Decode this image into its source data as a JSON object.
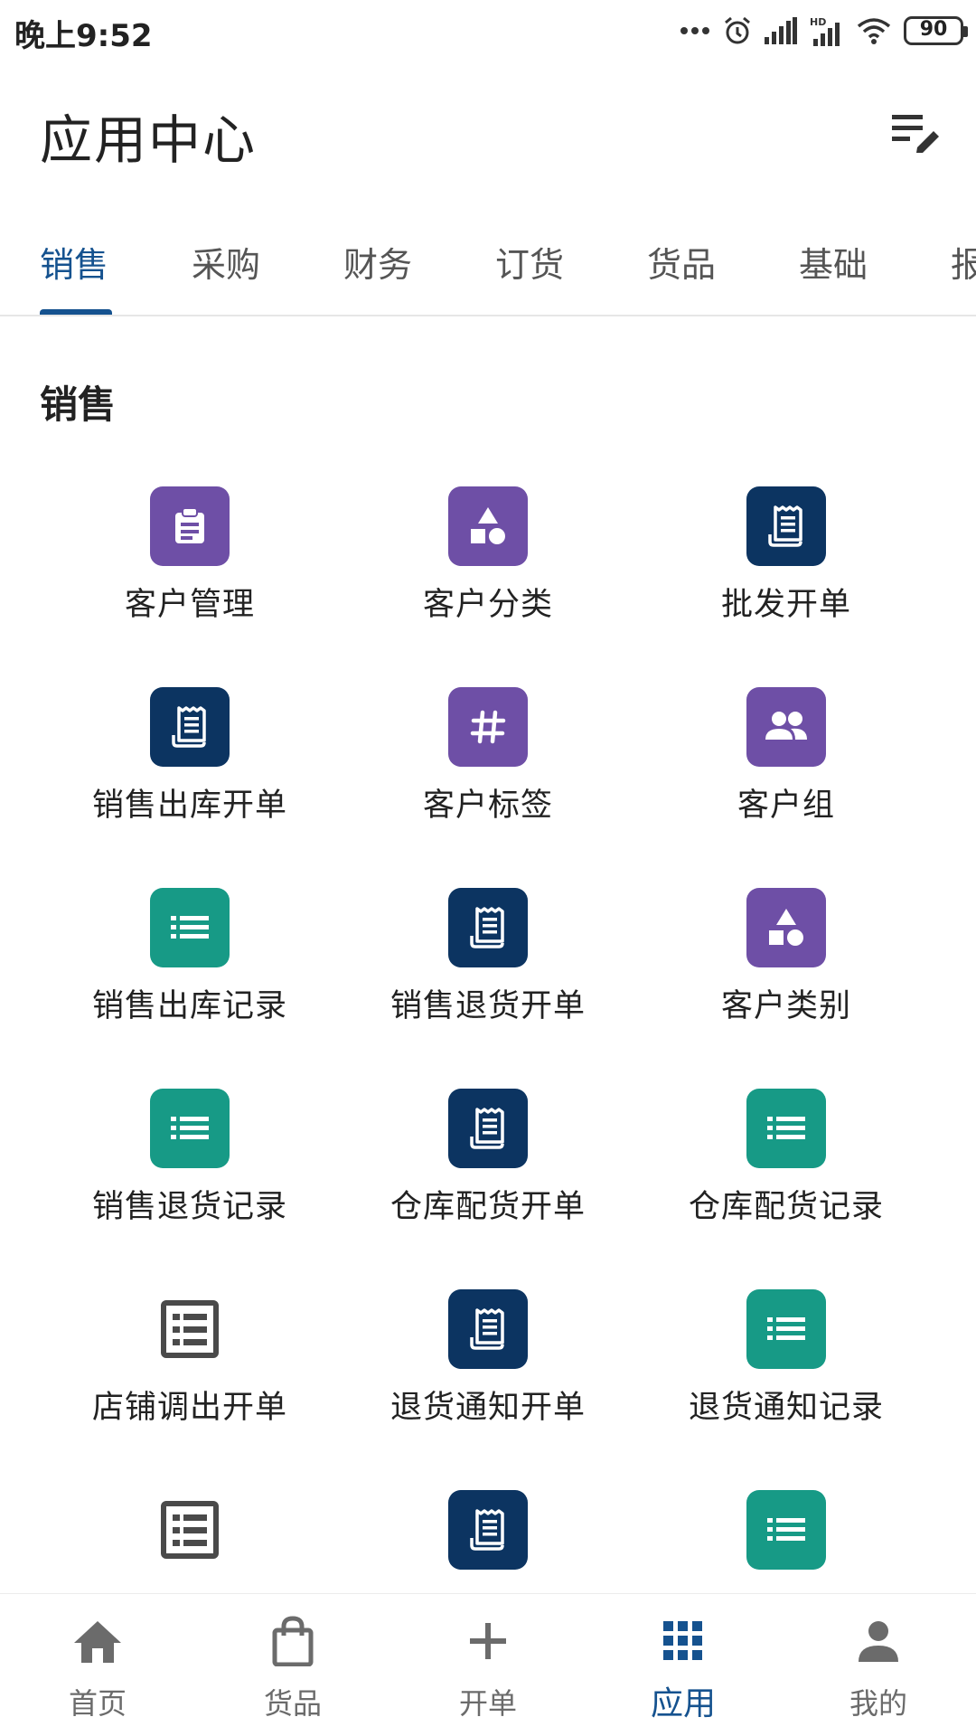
{
  "status_bar": {
    "time": "晚上9:52",
    "battery": "90"
  },
  "header": {
    "title": "应用中心",
    "edit_icon": "edit-list-icon"
  },
  "tabs": [
    {
      "label": "销售",
      "active": true
    },
    {
      "label": "采购",
      "active": false
    },
    {
      "label": "财务",
      "active": false
    },
    {
      "label": "订货",
      "active": false
    },
    {
      "label": "货品",
      "active": false
    },
    {
      "label": "基础",
      "active": false
    },
    {
      "label": "报",
      "active": false
    }
  ],
  "section": {
    "title": "销售",
    "items": [
      {
        "label": "客户管理",
        "icon": "clipboard-icon",
        "color": "#6e4fa6"
      },
      {
        "label": "客户分类",
        "icon": "shapes-icon",
        "color": "#6e4fa6"
      },
      {
        "label": "批发开单",
        "icon": "receipt-icon",
        "color": "#0c3461"
      },
      {
        "label": "销售出库开单",
        "icon": "receipt-icon",
        "color": "#0c3461"
      },
      {
        "label": "客户标签",
        "icon": "hashtag-icon",
        "color": "#6e4fa6"
      },
      {
        "label": "客户组",
        "icon": "group-icon",
        "color": "#6e4fa6"
      },
      {
        "label": "销售出库记录",
        "icon": "list-icon",
        "color": "#179a86"
      },
      {
        "label": "销售退货开单",
        "icon": "receipt-icon",
        "color": "#0c3461"
      },
      {
        "label": "客户类别",
        "icon": "shapes-icon",
        "color": "#6e4fa6"
      },
      {
        "label": "销售退货记录",
        "icon": "list-icon",
        "color": "#179a86"
      },
      {
        "label": "仓库配货开单",
        "icon": "receipt-icon",
        "color": "#0c3461"
      },
      {
        "label": "仓库配货记录",
        "icon": "list-icon",
        "color": "#179a86"
      },
      {
        "label": "店铺调出开单",
        "icon": "document-list-icon",
        "color": "#4a4a4a"
      },
      {
        "label": "退货通知开单",
        "icon": "receipt-icon",
        "color": "#0c3461"
      },
      {
        "label": "退货通知记录",
        "icon": "list-icon",
        "color": "#179a86"
      },
      {
        "label": "",
        "icon": "document-list-icon",
        "color": "#4a4a4a"
      },
      {
        "label": "",
        "icon": "receipt-icon",
        "color": "#0c3461"
      },
      {
        "label": "",
        "icon": "list-icon",
        "color": "#179a86"
      }
    ]
  },
  "bottom_nav": [
    {
      "label": "首页",
      "icon": "home-icon",
      "active": false
    },
    {
      "label": "货品",
      "icon": "shopping-bag-icon",
      "active": false
    },
    {
      "label": "开单",
      "icon": "plus-icon",
      "active": false
    },
    {
      "label": "应用",
      "icon": "apps-grid-icon",
      "active": true
    },
    {
      "label": "我的",
      "icon": "person-icon",
      "active": false
    }
  ],
  "colors": {
    "accent": "#15528f",
    "purple": "#6e4fa6",
    "navy": "#0c3461",
    "teal": "#179a86"
  }
}
